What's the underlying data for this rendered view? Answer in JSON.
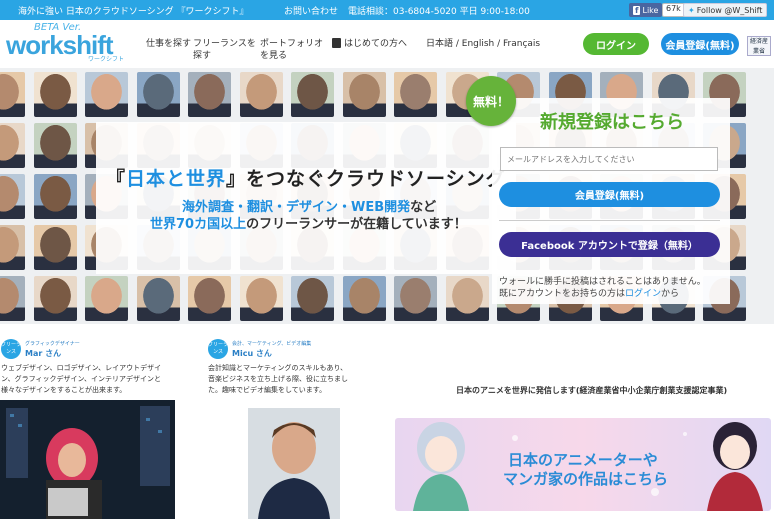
{
  "topbar": {
    "tagline": "海外に強い 日本のクラウドソーシング 『ワークシフト』",
    "contact": "お問い合わせ",
    "phone": "電話相談：03-6804-5020 平日 9:00-18:00",
    "fb_like": "Like",
    "fb_count": "67k",
    "twitter_follow": "Follow @W_Shift"
  },
  "header": {
    "logo_beta": "BETA Ver.",
    "logo_text": "workshift",
    "logo_kana": "ワークシフト",
    "nav": {
      "find_work": "仕事を探す",
      "find_freelancer": "フリーランスを探す",
      "portfolio": "ポートフォリオを見る",
      "first_time": "はじめての方へ",
      "languages": "日本語 / English / Français"
    },
    "login": "ログイン",
    "signup": "会員登録(無料)",
    "seal_text": "経済産業省"
  },
  "hero": {
    "title_open": "『",
    "title_hl": "日本と世界",
    "title_close": "』をつなぐクラウドソーシング",
    "sub1_hl": "海外調査・翻訳・デザイン・WEB開発",
    "sub1_tail": "など",
    "sub2_hl": "世界70カ国以上",
    "sub2_tail": "のフリーランサーが在籍しています！"
  },
  "register": {
    "free_badge": "無料！",
    "title": "新規登録はこちら",
    "email_placeholder": "メールアドレスを入力してください",
    "member_button": "会員登録(無料)",
    "facebook_button": "Facebook アカウントで登録（無料）",
    "note1": "ウォールに勝手に投稿はされることはありません。",
    "note2_pre": "既にアカウントをお持ちの方は",
    "note2_link": "ログイン",
    "note2_post": "から"
  },
  "freelancers": [
    {
      "badge": "フリーランス",
      "role": "グラフィックデザイナー",
      "name": "Mar さん",
      "desc": "ウェブデザイン、ロゴデザイン、レイアウトデザイン、グラフィックデザイン、インテリアデザインと様々なデザインをすることが出来ます。"
    },
    {
      "badge": "フリーランス",
      "role": "会計、マーケティング、ビデオ編集",
      "name": "Micu さん",
      "desc": "会計知識とマーケティングのスキルもあり、音楽ビジネスを立ち上げる際、役に立ちました。趣味でビデオ編集をしています。"
    }
  ],
  "anime": {
    "title": "日本のアニメを世界に発信します(経済産業省中小企業庁創業支援認定事業)",
    "line1": "日本のアニメーターや",
    "line2": "マンガ家の作品はこちら"
  }
}
